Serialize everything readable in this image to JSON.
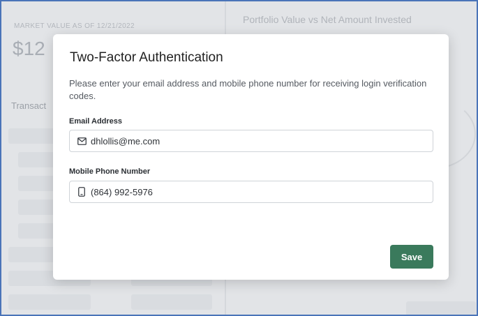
{
  "background": {
    "market_label": "MARKET VALUE AS OF 12/21/2022",
    "market_value": "$12",
    "transactions_label": "Transact",
    "chart_title": "Portfolio Value vs Net Amount Invested"
  },
  "modal": {
    "title": "Two-Factor Authentication",
    "description": "Please enter your email address and mobile phone number for receiving login verification codes.",
    "email": {
      "label": "Email Address",
      "value": "dhlollis@me.com",
      "icon": "envelope-icon"
    },
    "phone": {
      "label": "Mobile Phone Number",
      "value": "(864) 992-5976",
      "icon": "mobile-phone-icon"
    },
    "save_label": "Save",
    "accent_color": "#3a7a5c"
  }
}
